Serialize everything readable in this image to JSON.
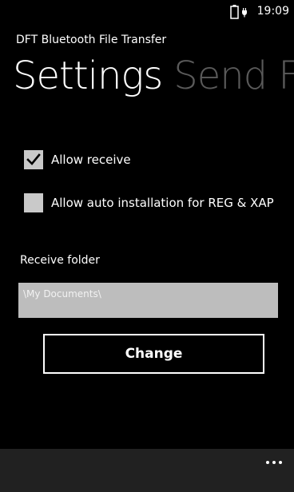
{
  "status_bar": {
    "time": "19:09",
    "battery_icon": "battery-charging-icon"
  },
  "app": {
    "title": "DFT Bluetooth File Transfer"
  },
  "pivot": {
    "items": [
      {
        "label": "Settings",
        "active": true
      },
      {
        "label": "Send F",
        "active": false
      }
    ]
  },
  "settings": {
    "allow_receive": {
      "label": "Allow receive",
      "checked": true
    },
    "allow_auto_install": {
      "label": "Allow auto installation for REG &  XAP",
      "checked": false
    },
    "receive_folder": {
      "label": "Receive folder",
      "value": "\\My Documents\\"
    },
    "change_button_label": "Change"
  },
  "app_bar": {
    "more_icon": "ellipsis-icon"
  },
  "colors": {
    "background": "#000000",
    "checkbox": "#c9c9c9",
    "input_background": "#bdbdbd",
    "inactive_pivot": "#5a5a5a",
    "app_bar": "#212121"
  }
}
